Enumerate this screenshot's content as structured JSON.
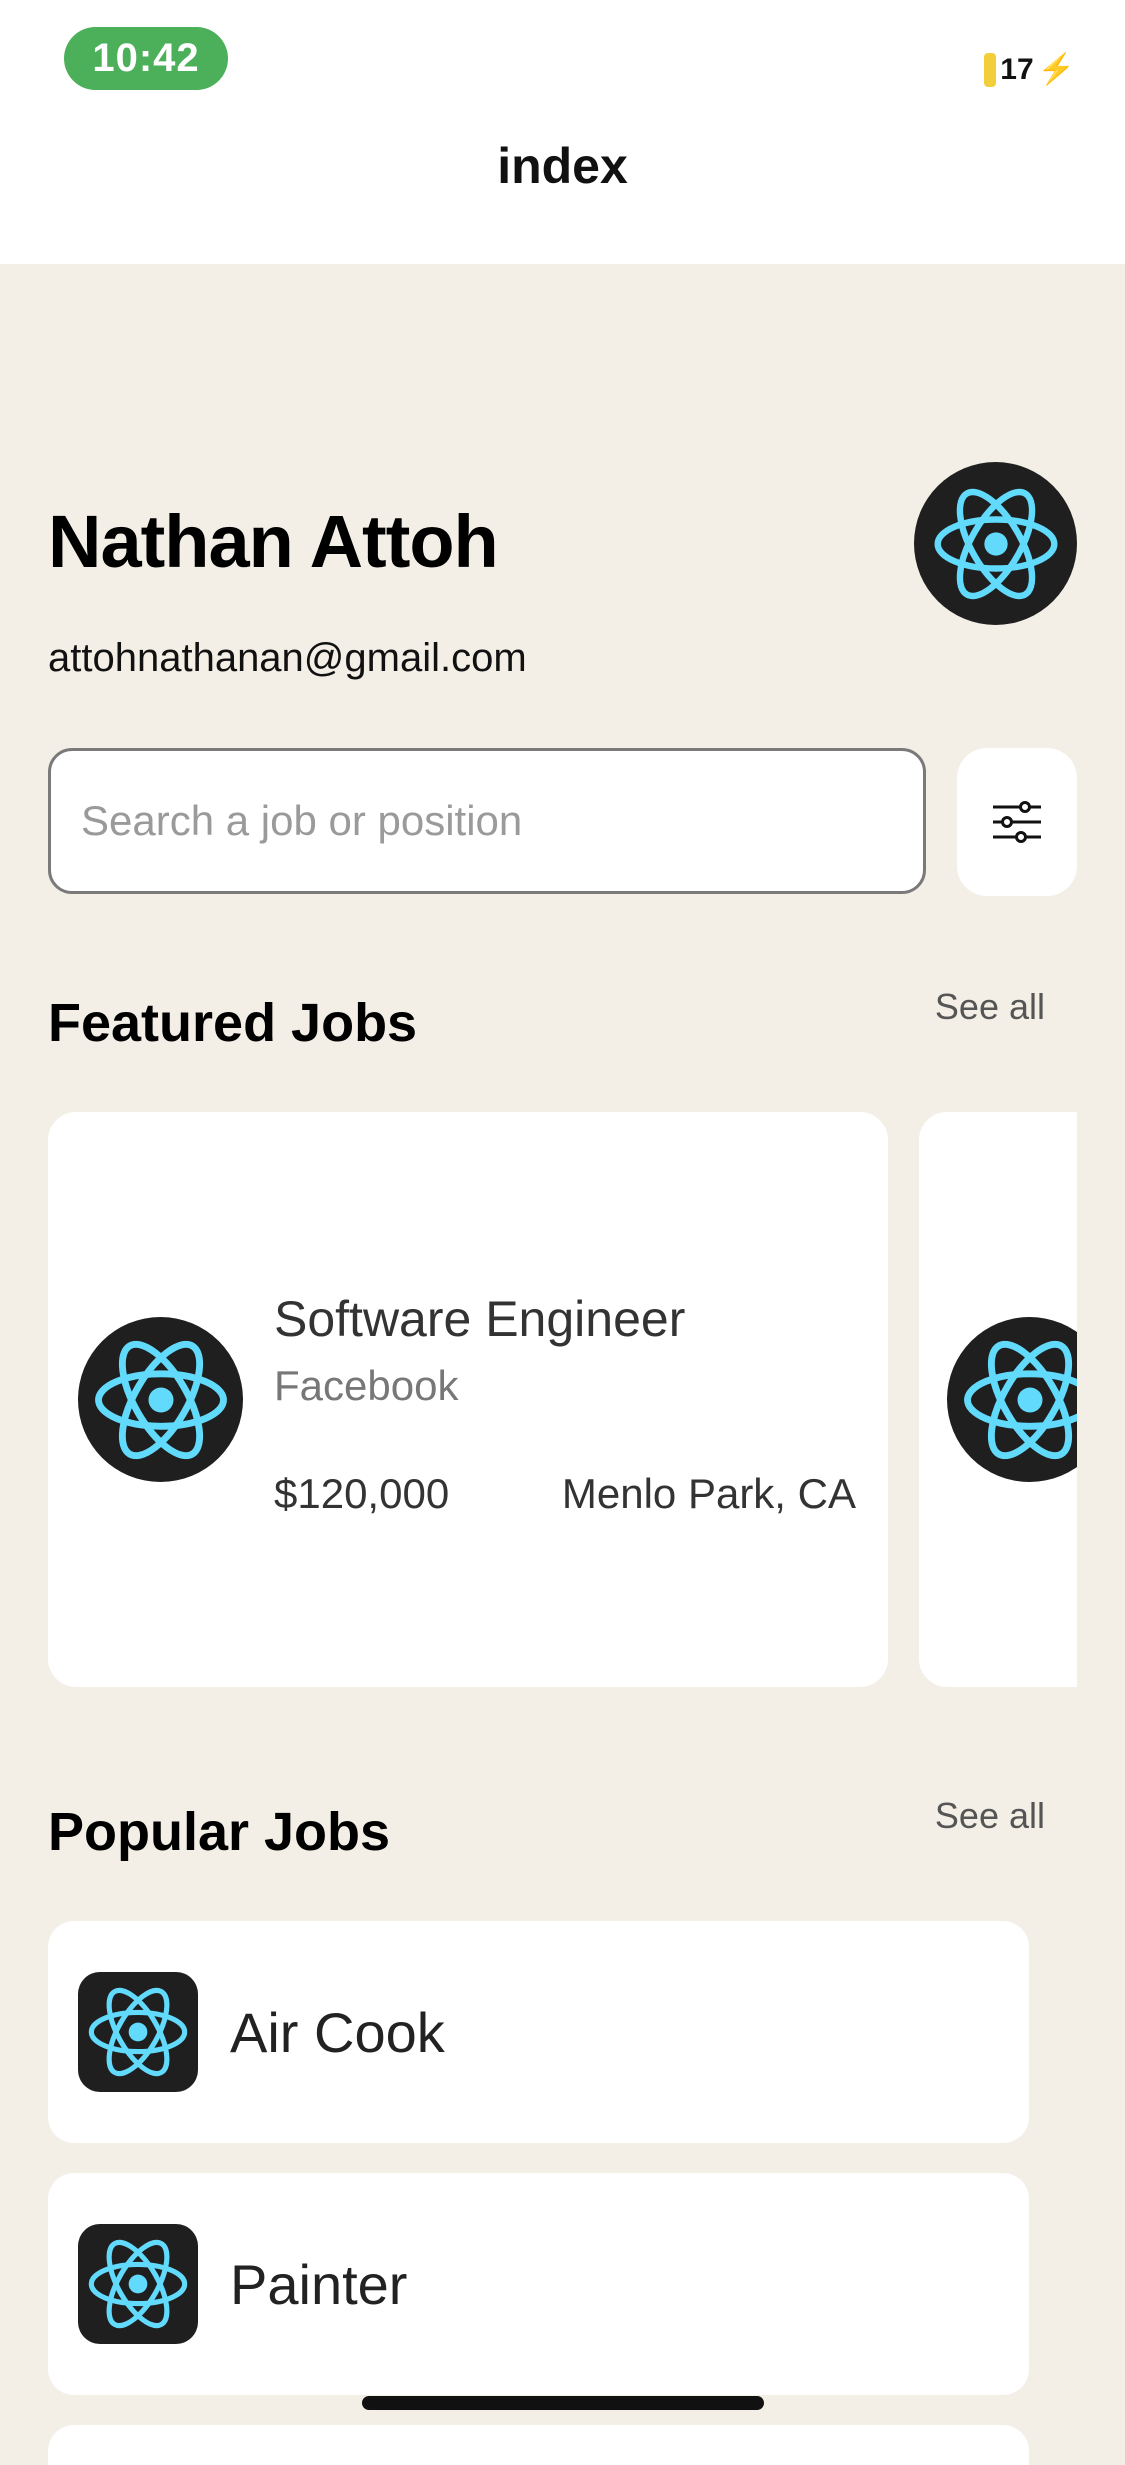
{
  "status": {
    "time": "10:42",
    "battery": "17"
  },
  "header": {
    "title": "index"
  },
  "profile": {
    "name": "Nathan Attoh",
    "email": "attohnathanan@gmail.com",
    "avatar_icon": "react-atom-icon"
  },
  "search": {
    "placeholder": "Search a job or position",
    "filter_icon": "sliders-icon"
  },
  "featured": {
    "title": "Featured Jobs",
    "see_all": "See all",
    "jobs": [
      {
        "title": "Software Engineer",
        "company": "Facebook",
        "salary": "$120,000",
        "location": "Menlo Park, CA",
        "logo_icon": "react-atom-icon"
      }
    ]
  },
  "popular": {
    "title": "Popular Jobs",
    "see_all": "See all",
    "jobs": [
      {
        "title": "Air Cook",
        "logo_icon": "react-atom-icon"
      },
      {
        "title": "Painter",
        "logo_icon": "react-atom-icon"
      }
    ]
  },
  "colors": {
    "background": "#f3efe6",
    "time_pill": "#4caf5a",
    "logo_bg": "#1f1f1f",
    "react_blue": "#61dafb"
  }
}
